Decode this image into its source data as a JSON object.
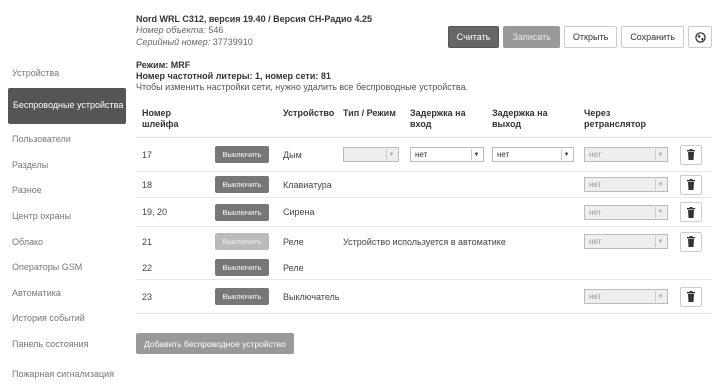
{
  "header": {
    "title": "Nord WRL C312, версия 19.40 / Версия СН-Радио 4.25",
    "object_label": "Номер объекта:",
    "object_value": "546",
    "serial_label": "Серийный номер:",
    "serial_value": "37739910"
  },
  "toolbar": {
    "read_label": "Считать",
    "write_label": "Записать",
    "open_label": "Открыть",
    "save_label": "Сохранить",
    "globe_icon": "globe-icon"
  },
  "sidebar": {
    "items": [
      {
        "label": "Устройства"
      },
      {
        "label": "Беспроводные устройства"
      },
      {
        "label": "Пользователи"
      },
      {
        "label": "Разделы"
      },
      {
        "label": "Разное"
      },
      {
        "label": "Центр охраны"
      },
      {
        "label": "Облако"
      },
      {
        "label": "Операторы GSM"
      },
      {
        "label": "Автоматика"
      },
      {
        "label": "История событий"
      },
      {
        "label": "Панель состояния"
      },
      {
        "label": "Пожарная сигнализация"
      }
    ],
    "active_index": 1
  },
  "mode": {
    "line1": "Режим: MRF",
    "line2": "Номер частотной литеры: 1, номер сети: 81",
    "line3": "Чтобы изменить настройки сети, нужно удалить все беспроводные устройства."
  },
  "table": {
    "headers": {
      "loop": "Номер шлейфа",
      "device": "Устройство",
      "type": "Тип / Режим",
      "delay_in": "Задержка на вход",
      "delay_out": "Задержка на выход",
      "repeater": "Через ретранслятор"
    },
    "off_label": "Выключить",
    "rows": [
      {
        "loop": "17",
        "device": "Дым",
        "type": "",
        "delay_in": "нет",
        "delay_out": "нет",
        "repeater": "нет"
      },
      {
        "loop": "18",
        "device": "Клавиатура",
        "repeater": "нет"
      },
      {
        "loop": "19, 20",
        "device": "Сирена",
        "repeater": "нет"
      },
      {
        "loop": "21",
        "device": "Реле",
        "note": "Устройство используется в автоматике",
        "repeater": "нет"
      },
      {
        "loop": "22",
        "device": "Реле"
      },
      {
        "loop": "23",
        "device": "Выключатель",
        "repeater": "нет"
      }
    ]
  },
  "add_button": "Добавить беспроводное устройство"
}
